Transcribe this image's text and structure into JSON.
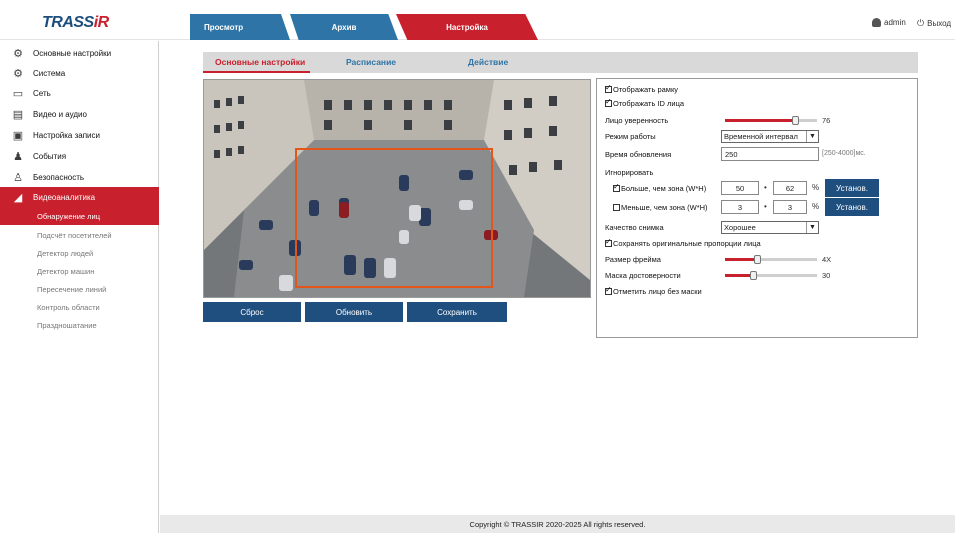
{
  "header": {
    "logo_main": "TRASS",
    "logo_accent": "iR",
    "tabs": [
      {
        "label": "Просмотр"
      },
      {
        "label": "Архив"
      },
      {
        "label": "Настройка"
      }
    ],
    "user": "admin",
    "logout": "Выход"
  },
  "sidebar": {
    "items": [
      {
        "label": "Основные настройки",
        "icon": "gear-icon"
      },
      {
        "label": "Система",
        "icon": "gears-icon"
      },
      {
        "label": "Сеть",
        "icon": "network-icon"
      },
      {
        "label": "Видео и аудио",
        "icon": "video-icon"
      },
      {
        "label": "Настройка записи",
        "icon": "save-icon"
      },
      {
        "label": "События",
        "icon": "bell-icon"
      },
      {
        "label": "Безопасность",
        "icon": "user-shield-icon"
      },
      {
        "label": "Видеоаналитика",
        "icon": "analytics-icon"
      }
    ],
    "subitems": [
      {
        "label": "Обнаружение лиц"
      },
      {
        "label": "Подсчёт посетителей"
      },
      {
        "label": "Детектор людей"
      },
      {
        "label": "Детектор машин"
      },
      {
        "label": "Пересечение линий"
      },
      {
        "label": "Контроль области"
      },
      {
        "label": "Праздношатание"
      }
    ]
  },
  "subtabs": [
    {
      "label": "Основные настройки"
    },
    {
      "label": "Расписание"
    },
    {
      "label": "Действие"
    }
  ],
  "buttons": {
    "reset": "Сброс",
    "refresh": "Обновить",
    "save": "Сохранить"
  },
  "settings": {
    "show_frame": "Отображать рамку",
    "show_face_id": "Отображать ID лица",
    "confidence": {
      "label": "Лицо уверенность",
      "value": "76",
      "fraction": 0.76
    },
    "mode": {
      "label": "Режим работы",
      "value": "Временной интервал"
    },
    "update_time": {
      "label": "Время обновления",
      "value": "250",
      "hint": "[250-4000]мс."
    },
    "ignore_label": "Игнорировать",
    "larger": {
      "label": "Больше, чем зона (W*H)",
      "w": "50",
      "h": "62",
      "unit": "%",
      "button": "Установ."
    },
    "smaller": {
      "label": "Меньше, чем зона (W*H)",
      "w": "3",
      "h": "3",
      "unit": "%",
      "button": "Установ."
    },
    "dot": "•",
    "quality": {
      "label": "Качество снимка",
      "value": "Хорошее"
    },
    "keep_ratio": "Сохранять оригинальные пропорции лица",
    "frame_size": {
      "label": "Размер фрейма",
      "value": "4X",
      "fraction": 0.35
    },
    "mask_confidence": {
      "label": "Маска достоверности",
      "value": "30",
      "fraction": 0.3
    },
    "mark_no_mask": "Отметить лицо без маски"
  },
  "footer": "Copyright © TRASSIR 2020-2025 All rights reserved.",
  "colors": {
    "accent": "#c8202c",
    "primary": "#2f74a6",
    "button": "#1f4f7f"
  }
}
